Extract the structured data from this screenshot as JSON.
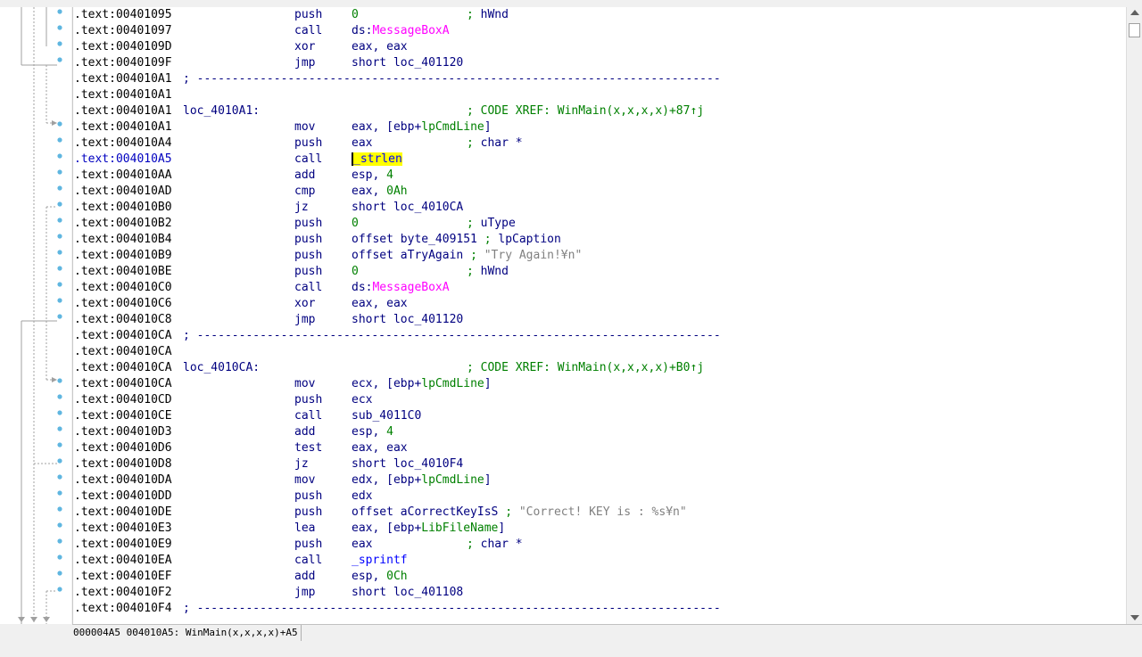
{
  "rows": [
    {
      "addr": ".text:00401095",
      "label": "",
      "mnemonic": "push",
      "operands": [
        {
          "t": "0",
          "c": "num"
        }
      ],
      "comment": [
        {
          "t": "; ",
          "c": "cmt"
        },
        {
          "t": "hWnd",
          "c": "reg"
        }
      ],
      "dot": true
    },
    {
      "addr": ".text:00401097",
      "label": "",
      "mnemonic": "call",
      "operands": [
        {
          "t": "ds:",
          "c": "reg"
        },
        {
          "t": "MessageBoxA",
          "c": "imp"
        }
      ],
      "comment": [],
      "dot": true
    },
    {
      "addr": ".text:0040109D",
      "label": "",
      "mnemonic": "xor",
      "operands": [
        {
          "t": "eax, eax",
          "c": "reg"
        }
      ],
      "comment": [],
      "dot": true
    },
    {
      "addr": ".text:0040109F",
      "label": "",
      "mnemonic": "jmp",
      "operands": [
        {
          "t": "short loc_401120",
          "c": "reg"
        }
      ],
      "comment": [],
      "dot": true
    },
    {
      "addr": ".text:004010A1",
      "label": "",
      "mnemonic": "",
      "operands": [],
      "comment": [],
      "sep": "; ---------------------------------------------------------------------------",
      "dot": false
    },
    {
      "addr": ".text:004010A1",
      "label": "",
      "mnemonic": "",
      "operands": [],
      "comment": [],
      "dot": false
    },
    {
      "addr": ".text:004010A1",
      "label": "loc_4010A1:",
      "mnemonic": "",
      "operands": [],
      "comment": [
        {
          "t": "; CODE XREF: WinMain(x,x,x,x)+87↑j",
          "c": "cmt"
        }
      ],
      "dot": false
    },
    {
      "addr": ".text:004010A1",
      "label": "",
      "mnemonic": "mov",
      "operands": [
        {
          "t": "eax, [ebp+",
          "c": "reg"
        },
        {
          "t": "lpCmdLine",
          "c": "var"
        },
        {
          "t": "]",
          "c": "reg"
        }
      ],
      "comment": [],
      "dot": true
    },
    {
      "addr": ".text:004010A4",
      "label": "",
      "mnemonic": "push",
      "operands": [
        {
          "t": "eax",
          "c": "reg"
        }
      ],
      "comment": [
        {
          "t": "; ",
          "c": "cmt"
        },
        {
          "t": "char *",
          "c": "reg"
        }
      ],
      "dot": true
    },
    {
      "addr": ".text:004010A5",
      "label": "",
      "mnemonic": "call",
      "operands": [
        {
          "t": "_strlen",
          "c": "func",
          "hl": true
        }
      ],
      "comment": [],
      "dot": true,
      "current": true
    },
    {
      "addr": ".text:004010AA",
      "label": "",
      "mnemonic": "add",
      "operands": [
        {
          "t": "esp, ",
          "c": "reg"
        },
        {
          "t": "4",
          "c": "num"
        }
      ],
      "comment": [],
      "dot": true
    },
    {
      "addr": ".text:004010AD",
      "label": "",
      "mnemonic": "cmp",
      "operands": [
        {
          "t": "eax, ",
          "c": "reg"
        },
        {
          "t": "0Ah",
          "c": "num"
        }
      ],
      "comment": [],
      "dot": true
    },
    {
      "addr": ".text:004010B0",
      "label": "",
      "mnemonic": "jz",
      "operands": [
        {
          "t": "short loc_4010CA",
          "c": "reg"
        }
      ],
      "comment": [],
      "dot": true
    },
    {
      "addr": ".text:004010B2",
      "label": "",
      "mnemonic": "push",
      "operands": [
        {
          "t": "0",
          "c": "num"
        }
      ],
      "comment": [
        {
          "t": "; ",
          "c": "cmt"
        },
        {
          "t": "uType",
          "c": "reg"
        }
      ],
      "dot": true
    },
    {
      "addr": ".text:004010B4",
      "label": "",
      "mnemonic": "push",
      "operands": [
        {
          "t": "offset byte_409151 ",
          "c": "reg"
        },
        {
          "t": "; ",
          "c": "cmt"
        },
        {
          "t": "lpCaption",
          "c": "reg"
        }
      ],
      "comment": [],
      "dot": true
    },
    {
      "addr": ".text:004010B9",
      "label": "",
      "mnemonic": "push",
      "operands": [
        {
          "t": "offset aTryAgain ",
          "c": "reg"
        },
        {
          "t": "; ",
          "c": "cmt"
        },
        {
          "t": "\"Try Again!¥n\"",
          "c": "str"
        }
      ],
      "comment": [],
      "dot": true
    },
    {
      "addr": ".text:004010BE",
      "label": "",
      "mnemonic": "push",
      "operands": [
        {
          "t": "0",
          "c": "num"
        }
      ],
      "comment": [
        {
          "t": "; ",
          "c": "cmt"
        },
        {
          "t": "hWnd",
          "c": "reg"
        }
      ],
      "dot": true
    },
    {
      "addr": ".text:004010C0",
      "label": "",
      "mnemonic": "call",
      "operands": [
        {
          "t": "ds:",
          "c": "reg"
        },
        {
          "t": "MessageBoxA",
          "c": "imp"
        }
      ],
      "comment": [],
      "dot": true
    },
    {
      "addr": ".text:004010C6",
      "label": "",
      "mnemonic": "xor",
      "operands": [
        {
          "t": "eax, eax",
          "c": "reg"
        }
      ],
      "comment": [],
      "dot": true
    },
    {
      "addr": ".text:004010C8",
      "label": "",
      "mnemonic": "jmp",
      "operands": [
        {
          "t": "short loc_401120",
          "c": "reg"
        }
      ],
      "comment": [],
      "dot": true
    },
    {
      "addr": ".text:004010CA",
      "label": "",
      "mnemonic": "",
      "operands": [],
      "comment": [],
      "sep": "; ---------------------------------------------------------------------------",
      "dot": false
    },
    {
      "addr": ".text:004010CA",
      "label": "",
      "mnemonic": "",
      "operands": [],
      "comment": [],
      "dot": false
    },
    {
      "addr": ".text:004010CA",
      "label": "loc_4010CA:",
      "mnemonic": "",
      "operands": [],
      "comment": [
        {
          "t": "; CODE XREF: WinMain(x,x,x,x)+B0↑j",
          "c": "cmt"
        }
      ],
      "dot": false
    },
    {
      "addr": ".text:004010CA",
      "label": "",
      "mnemonic": "mov",
      "operands": [
        {
          "t": "ecx, [ebp+",
          "c": "reg"
        },
        {
          "t": "lpCmdLine",
          "c": "var"
        },
        {
          "t": "]",
          "c": "reg"
        }
      ],
      "comment": [],
      "dot": true
    },
    {
      "addr": ".text:004010CD",
      "label": "",
      "mnemonic": "push",
      "operands": [
        {
          "t": "ecx",
          "c": "reg"
        }
      ],
      "comment": [],
      "dot": true
    },
    {
      "addr": ".text:004010CE",
      "label": "",
      "mnemonic": "call",
      "operands": [
        {
          "t": "sub_4011C0",
          "c": "reg"
        }
      ],
      "comment": [],
      "dot": true
    },
    {
      "addr": ".text:004010D3",
      "label": "",
      "mnemonic": "add",
      "operands": [
        {
          "t": "esp, ",
          "c": "reg"
        },
        {
          "t": "4",
          "c": "num"
        }
      ],
      "comment": [],
      "dot": true
    },
    {
      "addr": ".text:004010D6",
      "label": "",
      "mnemonic": "test",
      "operands": [
        {
          "t": "eax, eax",
          "c": "reg"
        }
      ],
      "comment": [],
      "dot": true
    },
    {
      "addr": ".text:004010D8",
      "label": "",
      "mnemonic": "jz",
      "operands": [
        {
          "t": "short loc_4010F4",
          "c": "reg"
        }
      ],
      "comment": [],
      "dot": true
    },
    {
      "addr": ".text:004010DA",
      "label": "",
      "mnemonic": "mov",
      "operands": [
        {
          "t": "edx, [ebp+",
          "c": "reg"
        },
        {
          "t": "lpCmdLine",
          "c": "var"
        },
        {
          "t": "]",
          "c": "reg"
        }
      ],
      "comment": [],
      "dot": true
    },
    {
      "addr": ".text:004010DD",
      "label": "",
      "mnemonic": "push",
      "operands": [
        {
          "t": "edx",
          "c": "reg"
        }
      ],
      "comment": [],
      "dot": true
    },
    {
      "addr": ".text:004010DE",
      "label": "",
      "mnemonic": "push",
      "operands": [
        {
          "t": "offset aCorrectKeyIsS ",
          "c": "reg"
        },
        {
          "t": "; ",
          "c": "cmt"
        },
        {
          "t": "\"Correct! KEY is : %s¥n\"",
          "c": "str"
        }
      ],
      "comment": [],
      "dot": true
    },
    {
      "addr": ".text:004010E3",
      "label": "",
      "mnemonic": "lea",
      "operands": [
        {
          "t": "eax, [ebp+",
          "c": "reg"
        },
        {
          "t": "LibFileName",
          "c": "var"
        },
        {
          "t": "]",
          "c": "reg"
        }
      ],
      "comment": [],
      "dot": true
    },
    {
      "addr": ".text:004010E9",
      "label": "",
      "mnemonic": "push",
      "operands": [
        {
          "t": "eax",
          "c": "reg"
        }
      ],
      "comment": [
        {
          "t": "; ",
          "c": "cmt"
        },
        {
          "t": "char *",
          "c": "reg"
        }
      ],
      "dot": true
    },
    {
      "addr": ".text:004010EA",
      "label": "",
      "mnemonic": "call",
      "operands": [
        {
          "t": "_sprintf",
          "c": "func"
        }
      ],
      "comment": [],
      "dot": true
    },
    {
      "addr": ".text:004010EF",
      "label": "",
      "mnemonic": "add",
      "operands": [
        {
          "t": "esp, ",
          "c": "reg"
        },
        {
          "t": "0Ch",
          "c": "num"
        }
      ],
      "comment": [],
      "dot": true
    },
    {
      "addr": ".text:004010F2",
      "label": "",
      "mnemonic": "jmp",
      "operands": [
        {
          "t": "short loc_401108",
          "c": "reg"
        }
      ],
      "comment": [],
      "dot": true
    },
    {
      "addr": ".text:004010F4",
      "label": "",
      "mnemonic": "",
      "operands": [],
      "comment": [],
      "sep": "; ---------------------------------------------------------------------------",
      "dot": false
    }
  ],
  "status": {
    "text": "000004A5 004010A5: WinMain(x,x,x,x)+A5"
  },
  "colors": {
    "mnemonic": "#000080",
    "comment": "#008000",
    "import": "#ff00ff",
    "function": "#0000ff",
    "string": "#808080",
    "highlight": "#ffff00",
    "dot": "#5fb6e0"
  }
}
